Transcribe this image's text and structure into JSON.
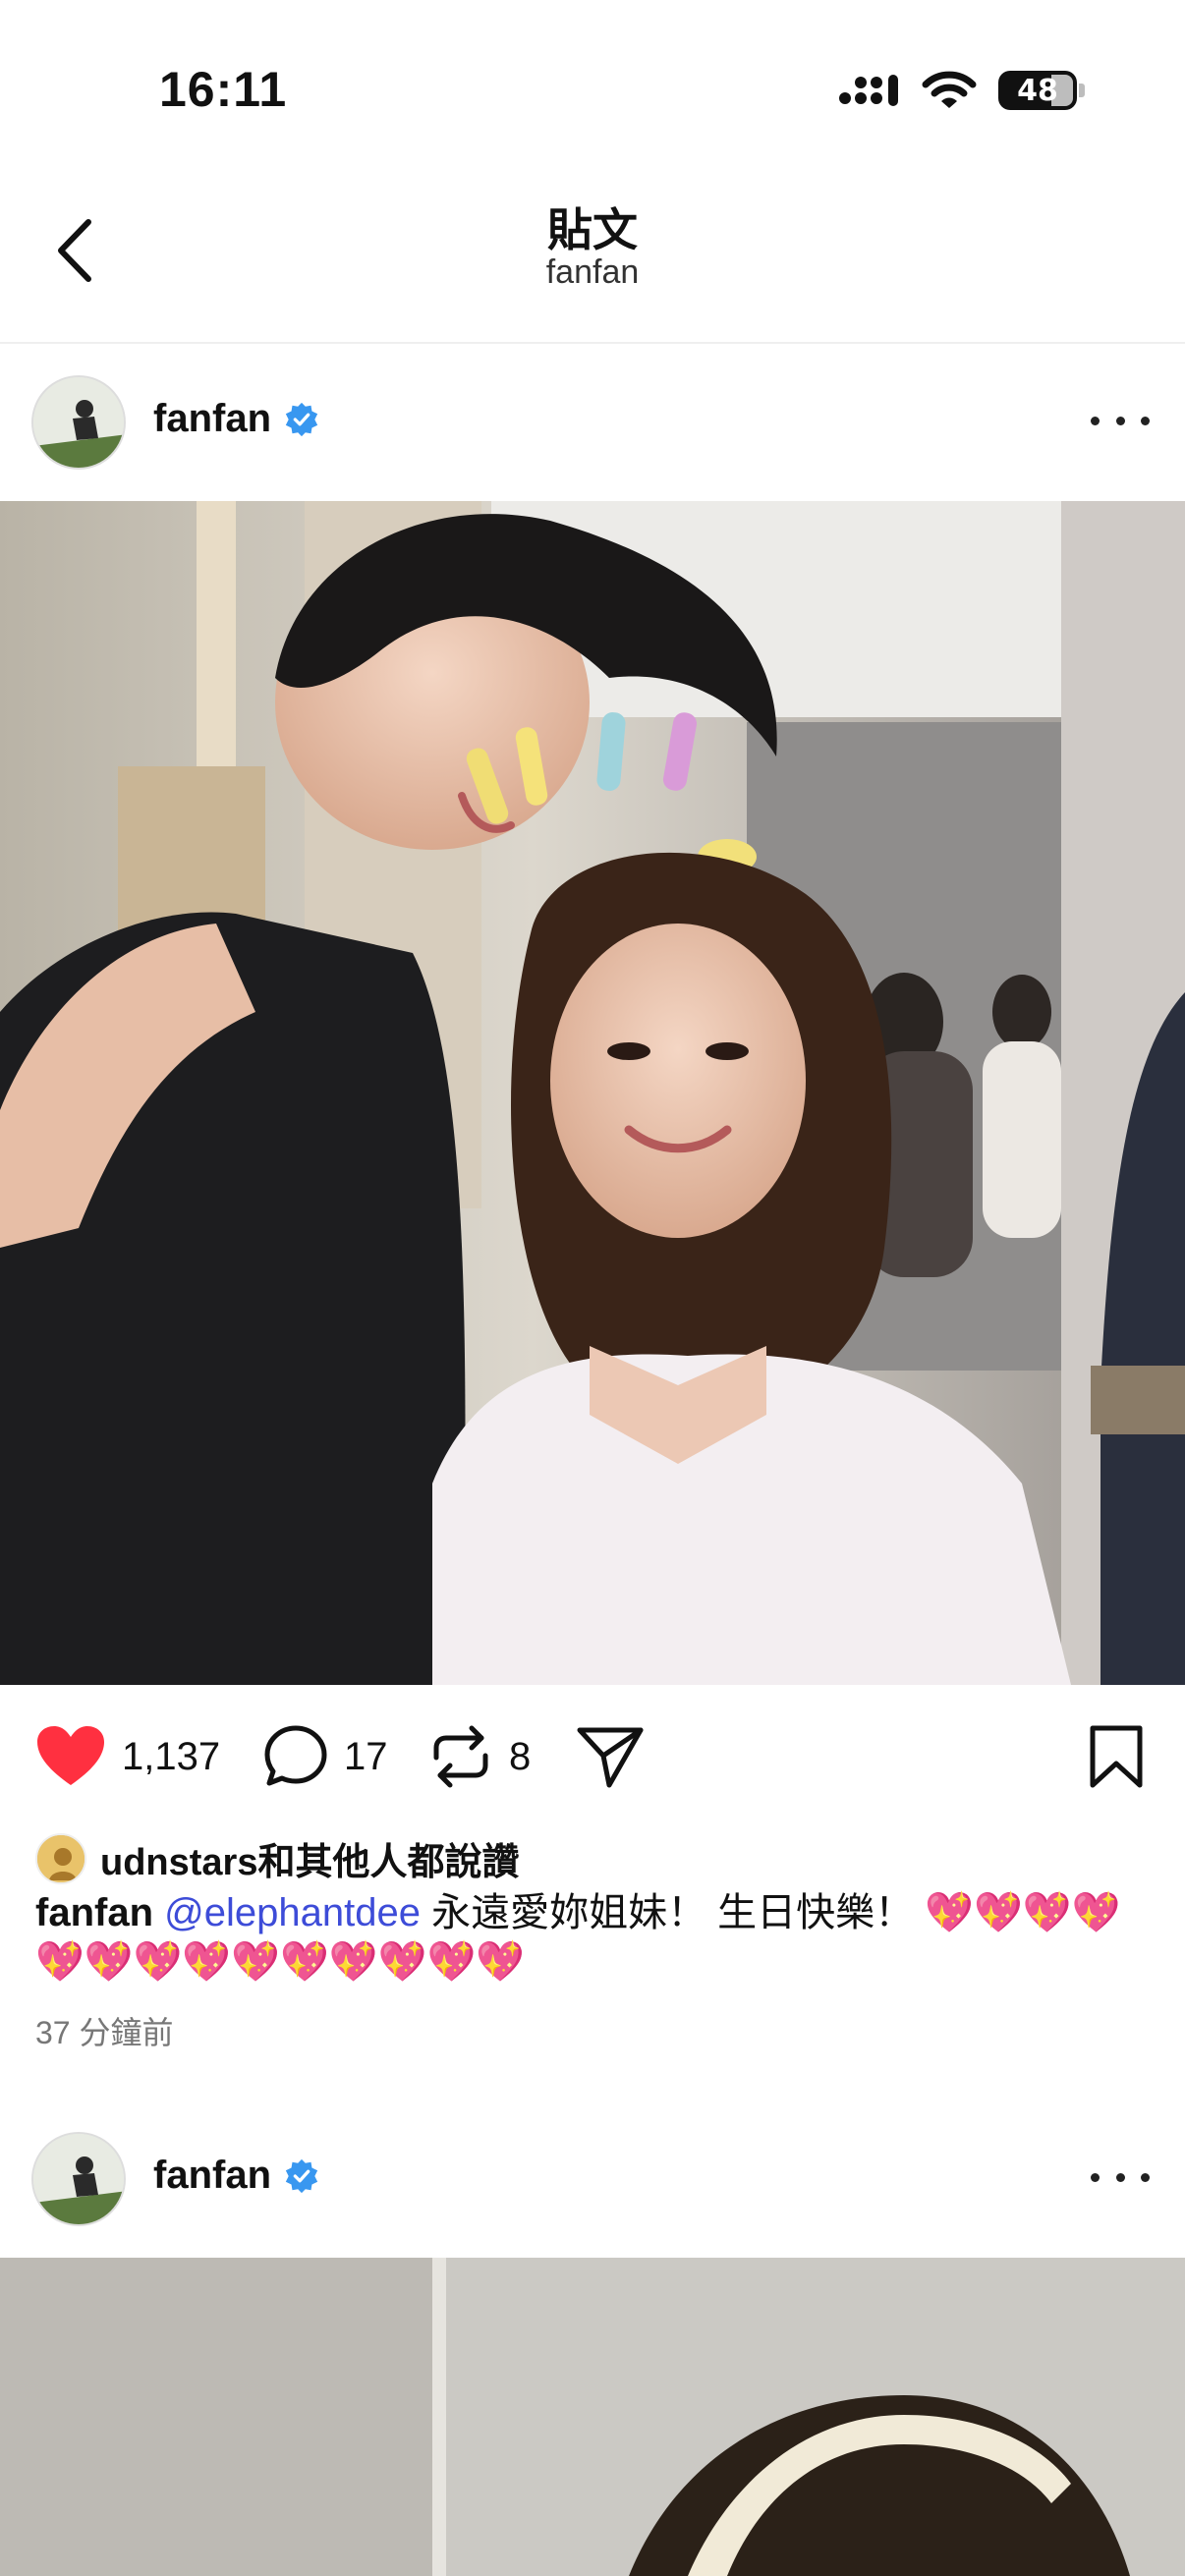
{
  "status_bar": {
    "time": "16:11",
    "battery": "48"
  },
  "header": {
    "title": "貼文",
    "subtitle": "fanfan"
  },
  "posts": [
    {
      "author": "fanfan",
      "likes": "1,137",
      "comments": "17",
      "reposts": "8",
      "liked_by_user": "udnstars",
      "liked_by_suffix": "和其他人都說讚",
      "caption_user": "fanfan",
      "caption_mention": "@elephantdee",
      "caption_text": " 永遠愛妳姐妹！ 生日快樂！ 💖💖💖💖💖💖💖💖💖💖💖💖💖💖",
      "time": "37 分鐘前"
    },
    {
      "author": "fanfan"
    }
  ],
  "colors": {
    "like_red": "#ff3040",
    "mention_blue": "#3d4cd8",
    "verified_blue": "#3897f0"
  }
}
